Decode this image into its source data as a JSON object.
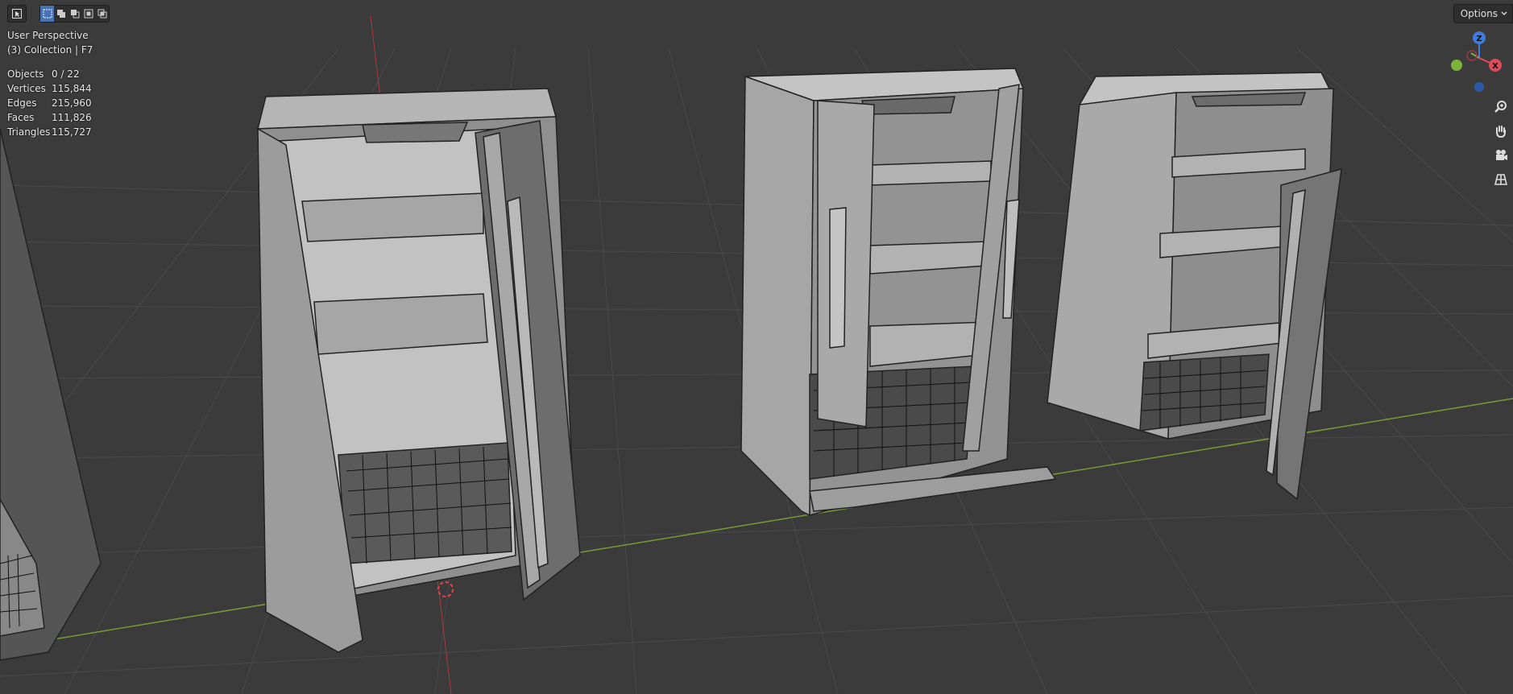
{
  "viewport": {
    "title": "User Perspective",
    "collection": "(3) Collection | F7",
    "stats": [
      {
        "label": "Objects",
        "value": "0 / 22"
      },
      {
        "label": "Vertices",
        "value": "115,844"
      },
      {
        "label": "Edges",
        "value": "215,960"
      },
      {
        "label": "Faces",
        "value": "111,826"
      },
      {
        "label": "Triangles",
        "value": "115,727"
      }
    ]
  },
  "header": {
    "options_label": "Options"
  },
  "gizmo": {
    "z_label": "Z",
    "x_label": "X",
    "colors": {
      "x": "#e04a5a",
      "y": "#7bb33a",
      "z": "#3f7ce0"
    }
  },
  "toolbar_icons": [
    "tweak-tool-icon",
    "select-new-icon",
    "select-extend-icon",
    "select-subtract-icon",
    "select-invert-icon",
    "select-intersect-icon"
  ],
  "nav_icons": [
    "zoom-icon",
    "pan-hand-icon",
    "camera-icon",
    "grid-perspective-icon"
  ],
  "colors": {
    "background": "#3b3b3b",
    "grid": "#4a4a4a",
    "x_axis": "#7a9a36",
    "y_axis": "#a83a3a",
    "accent": "#4772b3"
  }
}
